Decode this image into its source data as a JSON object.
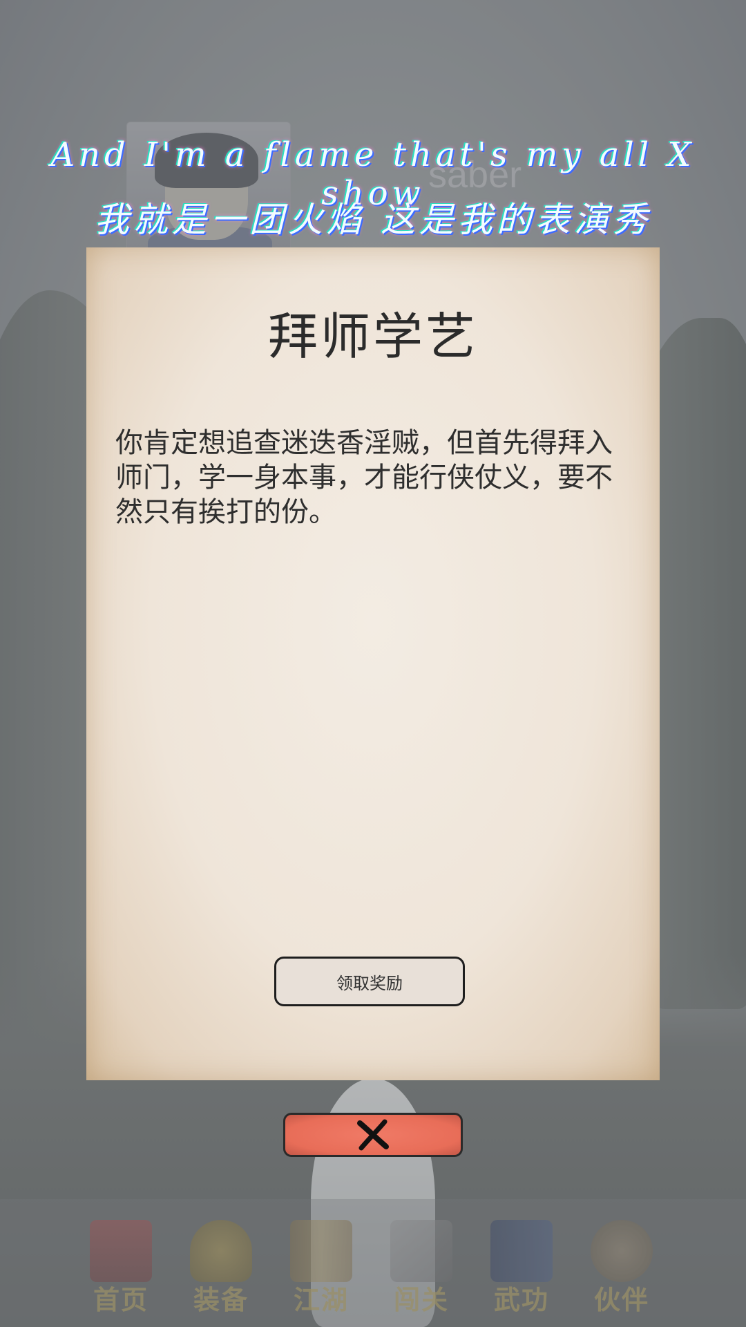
{
  "character": {
    "name": "saber"
  },
  "lyrics": {
    "en": "And I'm a flame that's my all X show",
    "cn": "我就是一团火焰 这是我的表演秀"
  },
  "dialog": {
    "title": "拜师学艺",
    "body": "你肯定想追查迷迭香淫贼，但首先得拜入师门，学一身本事，才能行侠仗义，要不然只有挨打的份。",
    "reward_button": "领取奖励"
  },
  "nav": {
    "items": [
      {
        "label": "首页",
        "icon": "home-icon",
        "color": "#b04a4a"
      },
      {
        "label": "装备",
        "icon": "armor-icon",
        "color": "#a08a3a"
      },
      {
        "label": "江湖",
        "icon": "scroll-icon",
        "color": "#9a8350"
      },
      {
        "label": "闯关",
        "icon": "swords-icon",
        "color": "#8c8c8c"
      },
      {
        "label": "武功",
        "icon": "manual-icon",
        "color": "#3f5a8c"
      },
      {
        "label": "伙伴",
        "icon": "partners-icon",
        "color": "#9a8a70"
      }
    ]
  },
  "colors": {
    "close_button": "#e86d58",
    "paper": "#efe5d9",
    "lyric": "#f4fbff"
  }
}
